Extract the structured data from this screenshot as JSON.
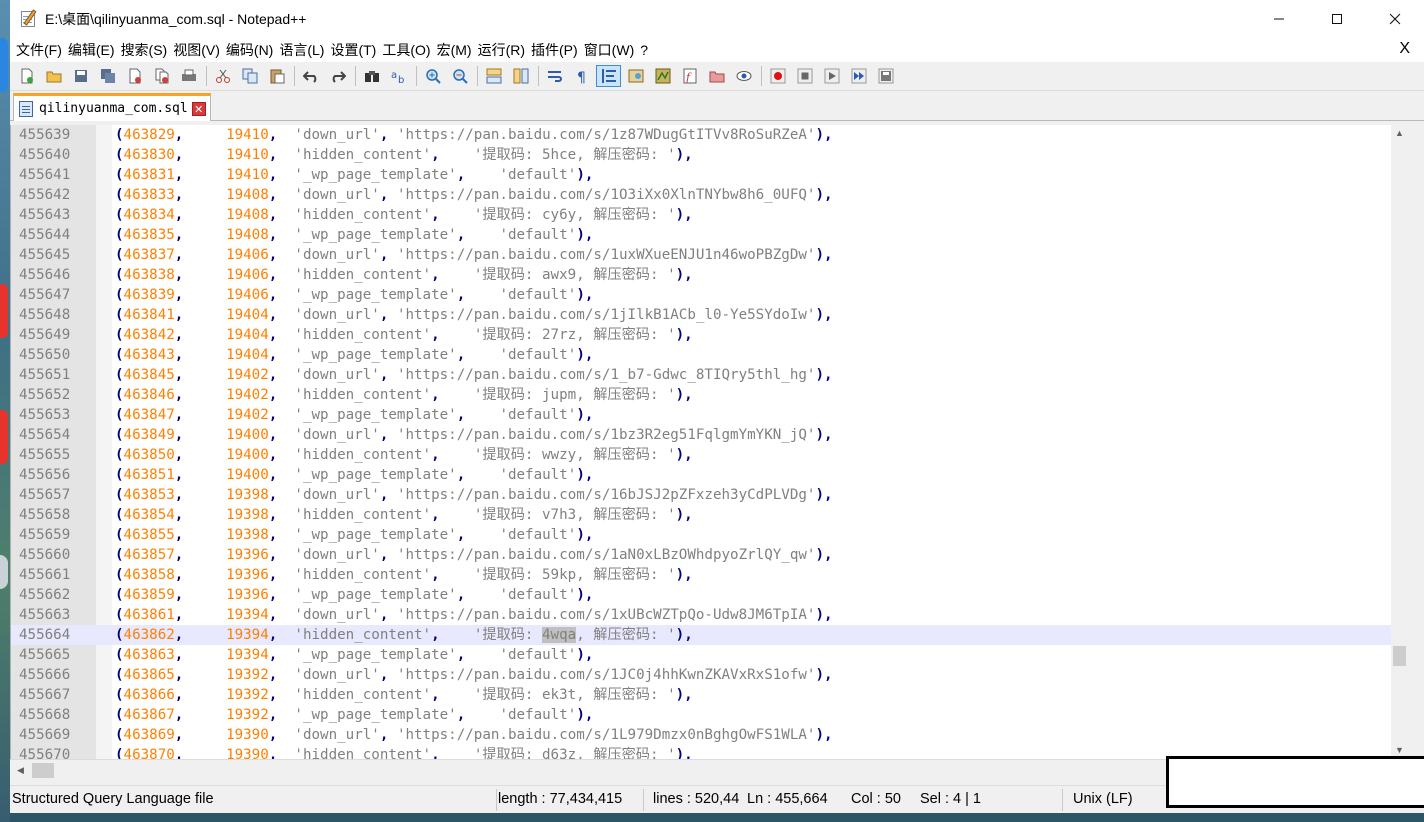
{
  "window": {
    "title": "E:\\桌面\\qilinyuanma_com.sql - Notepad++"
  },
  "menu": {
    "items": [
      "文件(F)",
      "编辑(E)",
      "搜索(S)",
      "视图(V)",
      "编码(N)",
      "语言(L)",
      "设置(T)",
      "工具(O)",
      "宏(M)",
      "运行(R)",
      "插件(P)",
      "窗口(W)",
      "?"
    ],
    "close_label": "X"
  },
  "tab": {
    "label": "qilinyuanma_com.sql"
  },
  "editor": {
    "lines": [
      {
        "ln": "455639",
        "id": "463829",
        "pid": "19410",
        "key": "'down_url'",
        "val": "'https://pan.baidu.com/s/1z87WDugGtITVv8RoSuRZeA'"
      },
      {
        "ln": "455640",
        "id": "463830",
        "pid": "19410",
        "key": "'hidden_content'",
        "val": "'提取码: 5hce, 解压密码: '"
      },
      {
        "ln": "455641",
        "id": "463831",
        "pid": "19410",
        "key": "'_wp_page_template'",
        "val": "'default'"
      },
      {
        "ln": "455642",
        "id": "463833",
        "pid": "19408",
        "key": "'down_url'",
        "val": "'https://pan.baidu.com/s/1O3iXx0XlnTNYbw8h6_0UFQ'"
      },
      {
        "ln": "455643",
        "id": "463834",
        "pid": "19408",
        "key": "'hidden_content'",
        "val": "'提取码: cy6y, 解压密码: '"
      },
      {
        "ln": "455644",
        "id": "463835",
        "pid": "19408",
        "key": "'_wp_page_template'",
        "val": "'default'"
      },
      {
        "ln": "455645",
        "id": "463837",
        "pid": "19406",
        "key": "'down_url'",
        "val": "'https://pan.baidu.com/s/1uxWXueENJU1n46woPBZgDw'"
      },
      {
        "ln": "455646",
        "id": "463838",
        "pid": "19406",
        "key": "'hidden_content'",
        "val": "'提取码: awx9, 解压密码: '"
      },
      {
        "ln": "455647",
        "id": "463839",
        "pid": "19406",
        "key": "'_wp_page_template'",
        "val": "'default'"
      },
      {
        "ln": "455648",
        "id": "463841",
        "pid": "19404",
        "key": "'down_url'",
        "val": "'https://pan.baidu.com/s/1jIlkB1ACb_l0-Ye5SYdoIw'"
      },
      {
        "ln": "455649",
        "id": "463842",
        "pid": "19404",
        "key": "'hidden_content'",
        "val": "'提取码: 27rz, 解压密码: '"
      },
      {
        "ln": "455650",
        "id": "463843",
        "pid": "19404",
        "key": "'_wp_page_template'",
        "val": "'default'"
      },
      {
        "ln": "455651",
        "id": "463845",
        "pid": "19402",
        "key": "'down_url'",
        "val": "'https://pan.baidu.com/s/1_b7-Gdwc_8TIQry5thl_hg'"
      },
      {
        "ln": "455652",
        "id": "463846",
        "pid": "19402",
        "key": "'hidden_content'",
        "val": "'提取码: jupm, 解压密码: '"
      },
      {
        "ln": "455653",
        "id": "463847",
        "pid": "19402",
        "key": "'_wp_page_template'",
        "val": "'default'"
      },
      {
        "ln": "455654",
        "id": "463849",
        "pid": "19400",
        "key": "'down_url'",
        "val": "'https://pan.baidu.com/s/1bz3R2eg51FqlgmYmYKN_jQ'"
      },
      {
        "ln": "455655",
        "id": "463850",
        "pid": "19400",
        "key": "'hidden_content'",
        "val": "'提取码: wwzy, 解压密码: '"
      },
      {
        "ln": "455656",
        "id": "463851",
        "pid": "19400",
        "key": "'_wp_page_template'",
        "val": "'default'"
      },
      {
        "ln": "455657",
        "id": "463853",
        "pid": "19398",
        "key": "'down_url'",
        "val": "'https://pan.baidu.com/s/16bJSJ2pZFxzeh3yCdPLVDg'"
      },
      {
        "ln": "455658",
        "id": "463854",
        "pid": "19398",
        "key": "'hidden_content'",
        "val": "'提取码: v7h3, 解压密码: '"
      },
      {
        "ln": "455659",
        "id": "463855",
        "pid": "19398",
        "key": "'_wp_page_template'",
        "val": "'default'"
      },
      {
        "ln": "455660",
        "id": "463857",
        "pid": "19396",
        "key": "'down_url'",
        "val": "'https://pan.baidu.com/s/1aN0xLBzOWhdpyoZrlQY_qw'"
      },
      {
        "ln": "455661",
        "id": "463858",
        "pid": "19396",
        "key": "'hidden_content'",
        "val": "'提取码: 59kp, 解压密码: '"
      },
      {
        "ln": "455662",
        "id": "463859",
        "pid": "19396",
        "key": "'_wp_page_template'",
        "val": "'default'"
      },
      {
        "ln": "455663",
        "id": "463861",
        "pid": "19394",
        "key": "'down_url'",
        "val": "'https://pan.baidu.com/s/1xUBcWZTpQo-Udw8JM6TpIA'"
      },
      {
        "ln": "455664",
        "id": "463862",
        "pid": "19394",
        "key": "'hidden_content'",
        "val_pre": "'提取码: ",
        "val_sel": "4wqa",
        "val_post": ", 解压密码: '",
        "current": true
      },
      {
        "ln": "455665",
        "id": "463863",
        "pid": "19394",
        "key": "'_wp_page_template'",
        "val": "'default'"
      },
      {
        "ln": "455666",
        "id": "463865",
        "pid": "19392",
        "key": "'down_url'",
        "val": "'https://pan.baidu.com/s/1JC0j4hhKwnZKAVxRxS1ofw'"
      },
      {
        "ln": "455667",
        "id": "463866",
        "pid": "19392",
        "key": "'hidden_content'",
        "val": "'提取码: ek3t, 解压密码: '"
      },
      {
        "ln": "455668",
        "id": "463867",
        "pid": "19392",
        "key": "'_wp_page_template'",
        "val": "'default'"
      },
      {
        "ln": "455669",
        "id": "463869",
        "pid": "19390",
        "key": "'down_url'",
        "val": "'https://pan.baidu.com/s/1L979Dmzx0nBghgOwFS1WLA'"
      },
      {
        "ln": "455670",
        "id": "463870",
        "pid": "19390",
        "key": "'hidden_content'",
        "val": "'提取码: d63z, 解压密码: '"
      }
    ]
  },
  "statusbar": {
    "language": "Structured Query Language file",
    "length": "length : 77,434,415",
    "lines": "lines : 520,44",
    "ln": "Ln : 455,664",
    "col": "Col : 50",
    "sel": "Sel : 4 | 1",
    "eol": "Unix (LF)"
  }
}
